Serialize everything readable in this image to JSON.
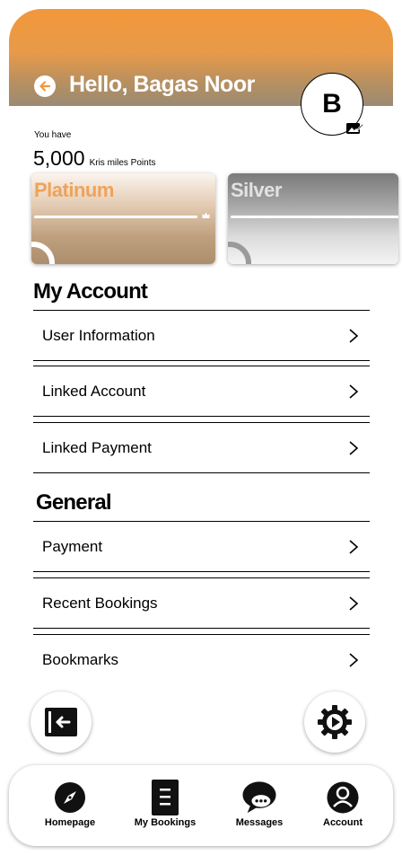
{
  "header": {
    "greeting": "Hello, Bagas Noor",
    "avatar_initial": "B",
    "gradient_start": "#f2973a",
    "gradient_end": "#9b8a74"
  },
  "points": {
    "caption": "You have",
    "value": "5,000",
    "unit": "Kris miles Points"
  },
  "tiers": [
    {
      "name": "Platinum",
      "color": "#eea35b"
    },
    {
      "name": "Silver",
      "color": "#e2e2e2"
    }
  ],
  "my_account": {
    "title": "My Account",
    "items": [
      {
        "label": "User Information"
      },
      {
        "label": "Linked Account"
      },
      {
        "label": "Linked Payment"
      }
    ]
  },
  "general": {
    "title": "General",
    "items": [
      {
        "label": "Payment"
      },
      {
        "label": "Recent Bookings"
      },
      {
        "label": "Bookmarks"
      }
    ]
  },
  "actions": {
    "logout_icon": "logout-icon",
    "settings_icon": "gear-icon"
  },
  "bottom_nav": {
    "items": [
      {
        "label": "Homepage",
        "icon": "compass-icon"
      },
      {
        "label": "My Bookings",
        "icon": "document-icon"
      },
      {
        "label": "Messages",
        "icon": "chat-icon"
      },
      {
        "label": "Account",
        "icon": "user-icon"
      }
    ]
  }
}
